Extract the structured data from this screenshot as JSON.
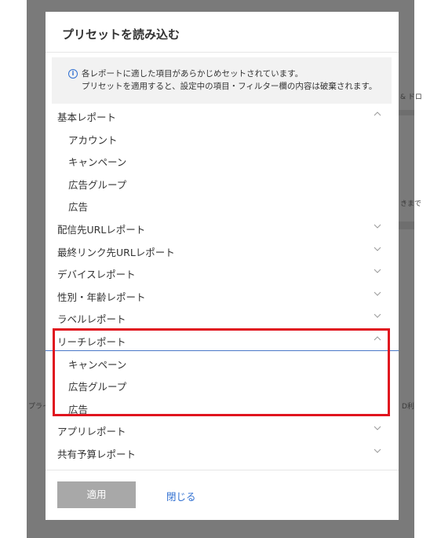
{
  "background": {
    "fragments": [
      "& ドロ",
      "きまで",
      "プライ",
      "D利"
    ]
  },
  "modal": {
    "title": "プリセットを読み込む",
    "notice": {
      "line1": "各レポートに適した項目があらかじめセットされています。",
      "line2": "プリセットを適用すると、設定中の項目・フィルター欄の内容は破棄されます。"
    },
    "items": [
      {
        "label": "基本レポート",
        "kind": "group",
        "expanded": true
      },
      {
        "label": "アカウント",
        "kind": "sub"
      },
      {
        "label": "キャンペーン",
        "kind": "sub"
      },
      {
        "label": "広告グループ",
        "kind": "sub"
      },
      {
        "label": "広告",
        "kind": "sub"
      },
      {
        "label": "配信先URLレポート",
        "kind": "group",
        "expanded": false
      },
      {
        "label": "最終リンク先URLレポート",
        "kind": "group",
        "expanded": false
      },
      {
        "label": "デバイスレポート",
        "kind": "group",
        "expanded": false
      },
      {
        "label": "性別・年齢レポート",
        "kind": "group",
        "expanded": false
      },
      {
        "label": "ラベルレポート",
        "kind": "group",
        "expanded": false
      },
      {
        "label": "リーチレポート",
        "kind": "group",
        "expanded": true
      },
      {
        "label": "キャンペーン",
        "kind": "sub"
      },
      {
        "label": "広告グループ",
        "kind": "sub"
      },
      {
        "label": "広告",
        "kind": "sub"
      },
      {
        "label": "アプリレポート",
        "kind": "group",
        "expanded": false
      },
      {
        "label": "共有予算レポート",
        "kind": "group",
        "expanded": false
      }
    ],
    "footer": {
      "apply_label": "適用",
      "close_label": "閉じる"
    }
  },
  "colors": {
    "highlight": "#e0141e",
    "link": "#2f6fd1",
    "apply_disabled": "#a8a8a8"
  }
}
